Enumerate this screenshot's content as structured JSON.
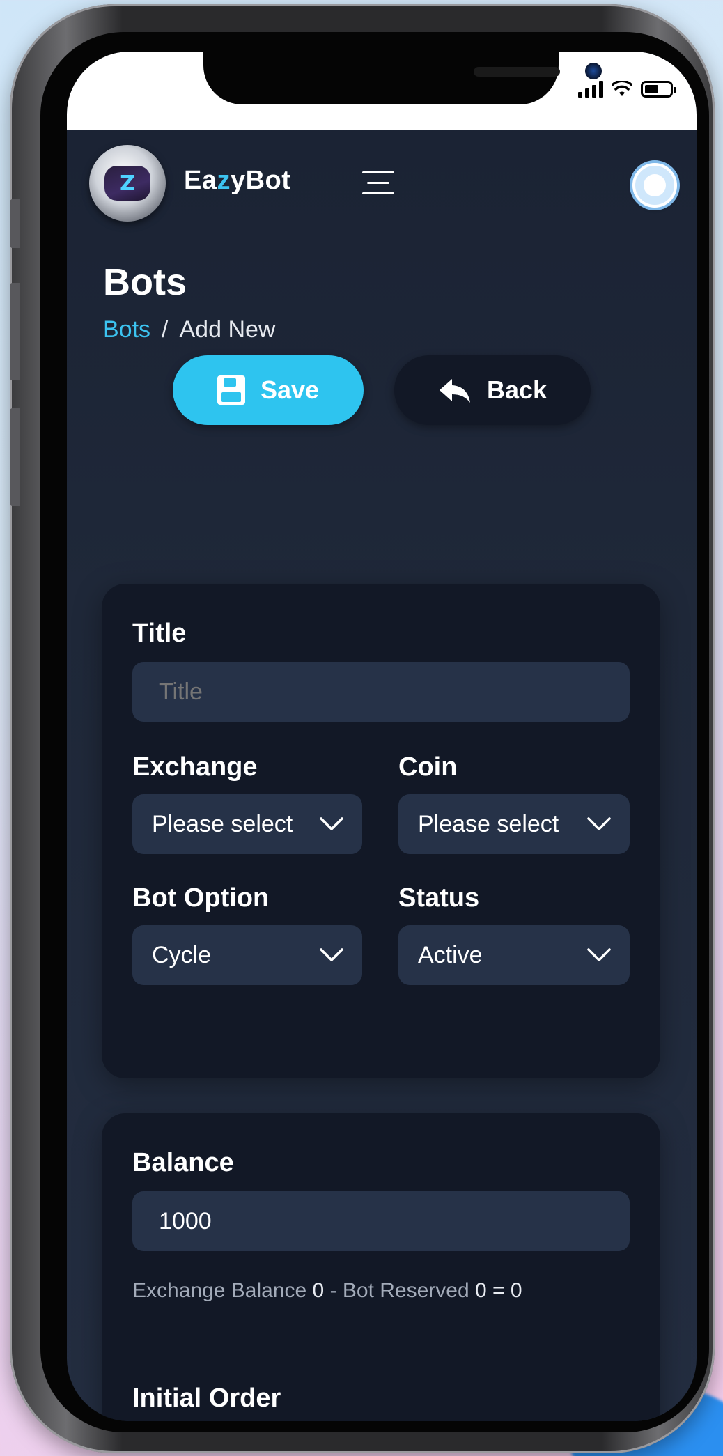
{
  "app": {
    "brand_prefix": "Ea",
    "brand_highlight": "z",
    "brand_suffix": "yBot",
    "logo_letter": "Z"
  },
  "page": {
    "title": "Bots",
    "breadcrumb": [
      {
        "label": "Bots"
      },
      {
        "label": "/"
      },
      {
        "label": "Add New"
      }
    ]
  },
  "actions": {
    "save_label": "Save",
    "back_label": "Back"
  },
  "form": {
    "title_label": "Title",
    "title_placeholder": "Title",
    "exchange_label": "Exchange",
    "exchange_value": "Please select",
    "coin_label": "Coin",
    "coin_value": "Please select",
    "bot_option_label": "Bot Option",
    "bot_option_value": "Cycle",
    "status_label": "Status",
    "status_value": "Active",
    "balance_label": "Balance",
    "balance_value": "1000",
    "balance_helper": {
      "exchange_text": "Exchange Balance",
      "exchange_value": "0",
      "dash": "-",
      "reserved_text": "Bot Reserved",
      "reserved_value": "0",
      "equals": "=",
      "result": "0"
    },
    "initial_order_label": "Initial Order"
  },
  "colors": {
    "accent": "#2ec4ef",
    "background": "#1f2839",
    "card": "#121826",
    "field": "#263248"
  },
  "icons": {
    "save": "floppy-disk-icon",
    "back": "reply-arrow-icon",
    "menu": "hamburger-menu-icon",
    "dropdown": "chevron-down-icon"
  }
}
